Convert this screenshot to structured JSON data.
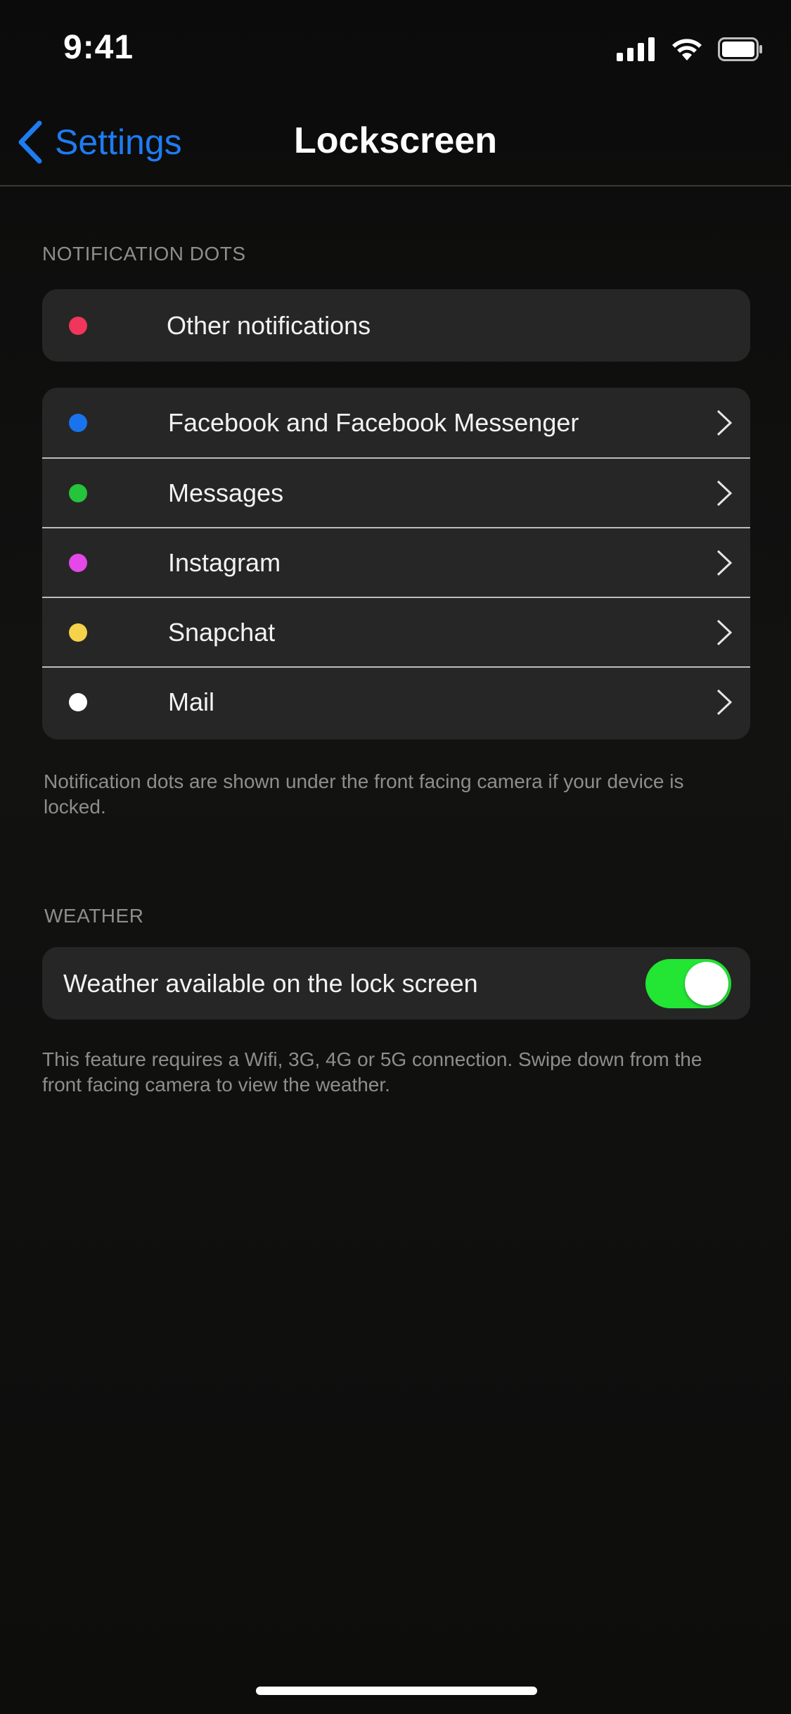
{
  "status_bar": {
    "time": "9:41",
    "icons": [
      "cellular-signal-icon",
      "wifi-icon",
      "battery-icon"
    ]
  },
  "nav": {
    "back_label": "Settings",
    "title": "Lockscreen"
  },
  "notification_dots": {
    "header": "NOTIFICATION DOTS",
    "other": {
      "label": "Other notifications",
      "color": "#f0365a"
    },
    "apps": [
      {
        "label": "Facebook and Facebook Messenger",
        "color": "#1a73ee"
      },
      {
        "label": "Messages",
        "color": "#25c43a"
      },
      {
        "label": "Instagram",
        "color": "#e548e8"
      },
      {
        "label": "Snapchat",
        "color": "#f6d24a"
      },
      {
        "label": "Mail",
        "color": "#ffffff"
      }
    ],
    "footnote": "Notification dots are shown under the front facing camera if your device is locked."
  },
  "weather": {
    "header": "WEATHER",
    "toggle_label": "Weather available on the lock screen",
    "toggle_on": true,
    "footnote": "This feature requires a Wifi, 3G, 4G or 5G connection. Swipe down from the front facing camera to view the weather."
  },
  "colors": {
    "accent": "#1e7cf2",
    "toggle_on": "#22e534",
    "card_bg": "#262626"
  }
}
